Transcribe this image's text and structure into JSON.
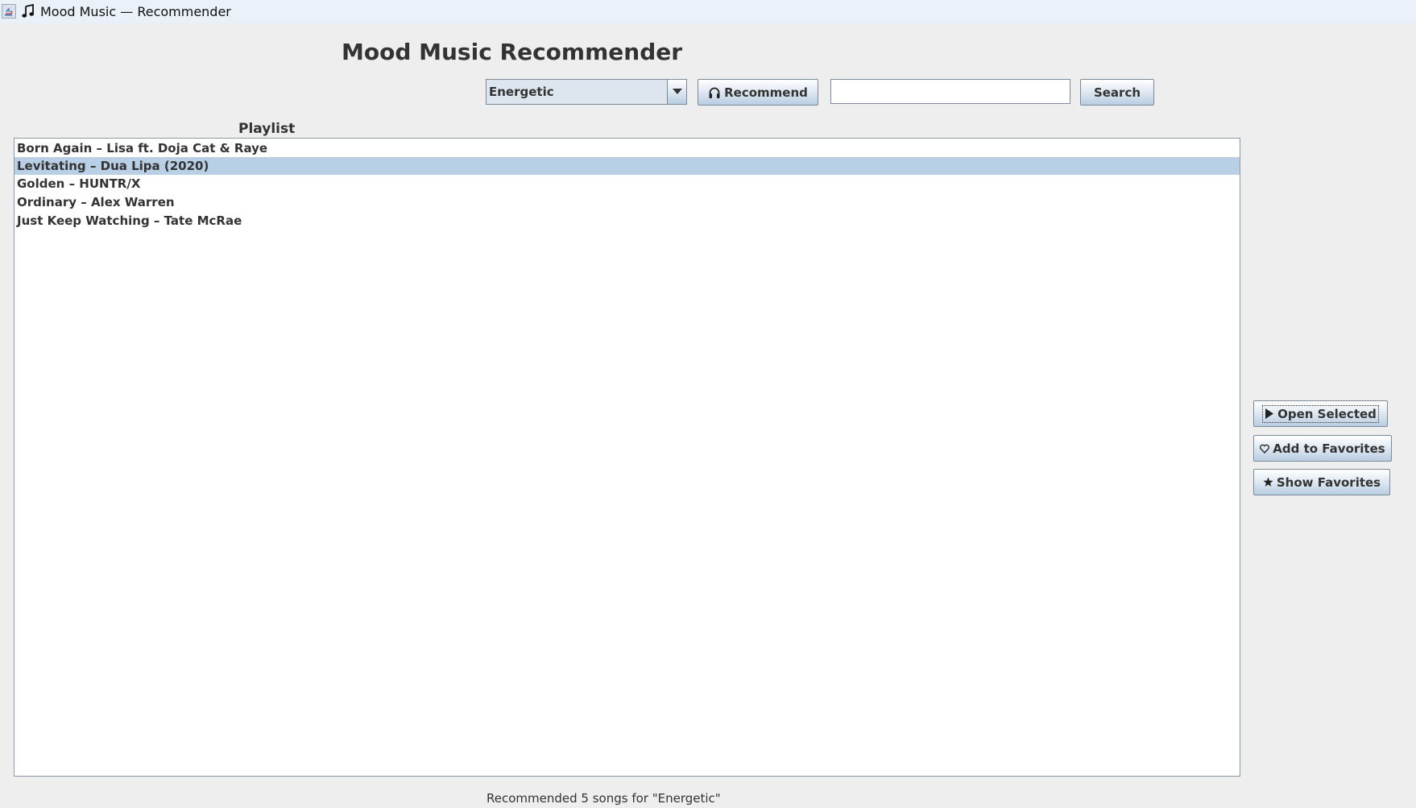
{
  "window": {
    "title": "Mood Music — Recommender"
  },
  "header": {
    "title": "Mood Music Recommender"
  },
  "toolbar": {
    "mood_selected": "Energetic",
    "recommend_label": "Recommend",
    "search_value": "",
    "search_label": "Search"
  },
  "playlist": {
    "label": "Playlist",
    "items": [
      {
        "text": "Born Again – Lisa ft. Doja Cat & Raye",
        "selected": false
      },
      {
        "text": "Levitating – Dua Lipa (2020)",
        "selected": true
      },
      {
        "text": "Golden – HUNTR/X",
        "selected": false
      },
      {
        "text": "Ordinary – Alex Warren",
        "selected": false
      },
      {
        "text": "Just Keep Watching – Tate McRae",
        "selected": false
      }
    ]
  },
  "actions": {
    "open_label": "Open Selected",
    "add_favorites_label": "Add to Favorites",
    "show_favorites_label": "Show Favorites"
  },
  "status": {
    "text": "Recommended 5 songs for \"Energetic\""
  },
  "colors": {
    "background": "#eeeeee",
    "selection": "#b8cfe5",
    "titlebar": "#eaf1f9"
  },
  "icons": {
    "app": "java-icon",
    "window": "music-note-icon",
    "recommend": "headphones-icon",
    "open": "play-icon",
    "add_favorites": "heart-icon",
    "show_favorites": "star-icon"
  }
}
